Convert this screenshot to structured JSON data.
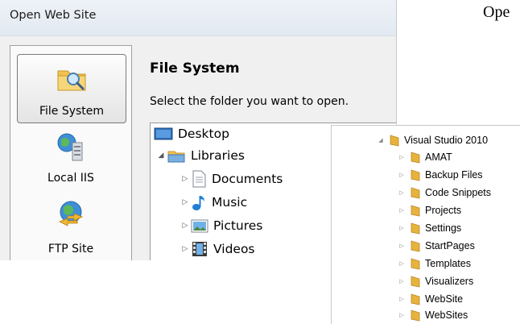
{
  "background": {
    "cutoff_text": "Ope"
  },
  "dialog": {
    "title": "Open Web Site",
    "sidebar": {
      "items": [
        {
          "label": "File System",
          "icon": "folder-search-icon",
          "selected": true
        },
        {
          "label": "Local IIS",
          "icon": "local-iis-icon",
          "selected": false
        },
        {
          "label": "FTP Site",
          "icon": "ftp-site-icon",
          "selected": false
        }
      ]
    },
    "main": {
      "title": "File System",
      "instruction": "Select the folder you want to open.",
      "tree": [
        {
          "label": "Desktop",
          "icon": "desktop-icon",
          "level": 0,
          "state": "none"
        },
        {
          "label": "Libraries",
          "icon": "libraries-icon",
          "level": 0,
          "state": "expanded"
        },
        {
          "label": "Documents",
          "icon": "documents-icon",
          "level": 1,
          "state": "collapsed"
        },
        {
          "label": "Music",
          "icon": "music-icon",
          "level": 1,
          "state": "collapsed"
        },
        {
          "label": "Pictures",
          "icon": "pictures-icon",
          "level": 1,
          "state": "collapsed"
        },
        {
          "label": "Videos",
          "icon": "videos-icon",
          "level": 1,
          "state": "collapsed"
        }
      ]
    }
  },
  "folder_tree": {
    "root": {
      "label": "Visual Studio 2010",
      "state": "expanded"
    },
    "children": [
      {
        "label": "AMAT"
      },
      {
        "label": "Backup Files"
      },
      {
        "label": "Code Snippets"
      },
      {
        "label": "Projects"
      },
      {
        "label": "Settings"
      },
      {
        "label": "StartPages"
      },
      {
        "label": "Templates"
      },
      {
        "label": "Visualizers"
      },
      {
        "label": "WebSite"
      },
      {
        "label": "WebSites"
      }
    ]
  },
  "colors": {
    "folder": "#e8b33c",
    "selection_border": "#7a7a7a",
    "titlebar": "#e3e9f2"
  }
}
